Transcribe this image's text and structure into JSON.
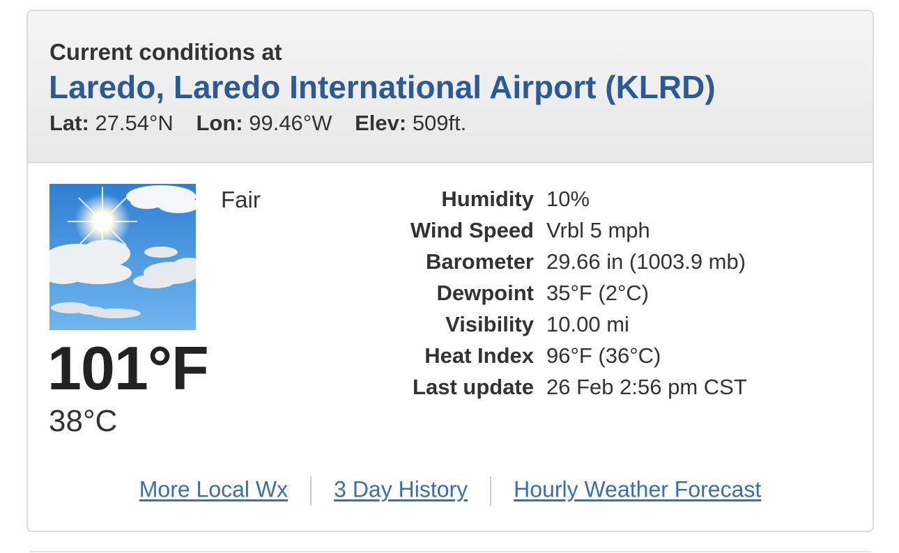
{
  "header": {
    "label": "Current conditions at",
    "station": "Laredo, Laredo International Airport (KLRD)",
    "lat_label": "Lat:",
    "lat_value": "27.54°N",
    "lon_label": "Lon:",
    "lon_value": "99.46°W",
    "elev_label": "Elev:",
    "elev_value": "509ft."
  },
  "current": {
    "icon": "sunny-with-clouds-icon",
    "condition": "Fair",
    "temp_f": "101°F",
    "temp_c": "38°C"
  },
  "details": [
    {
      "label": "Humidity",
      "value": "10%"
    },
    {
      "label": "Wind Speed",
      "value": "Vrbl 5 mph"
    },
    {
      "label": "Barometer",
      "value": "29.66 in (1003.9 mb)"
    },
    {
      "label": "Dewpoint",
      "value": "35°F (2°C)"
    },
    {
      "label": "Visibility",
      "value": "10.00 mi"
    },
    {
      "label": "Heat Index",
      "value": "96°F (36°C)"
    },
    {
      "label": "Last update",
      "value": "26 Feb 2:56 pm CST"
    }
  ],
  "links": {
    "more_local": "More Local Wx",
    "history": "3 Day History",
    "hourly": "Hourly Weather Forecast"
  },
  "colors": {
    "title": "#2c5b94",
    "link": "#3b6fa8",
    "header_bg": "#eeeeee",
    "sky": "#4a9ae2"
  }
}
